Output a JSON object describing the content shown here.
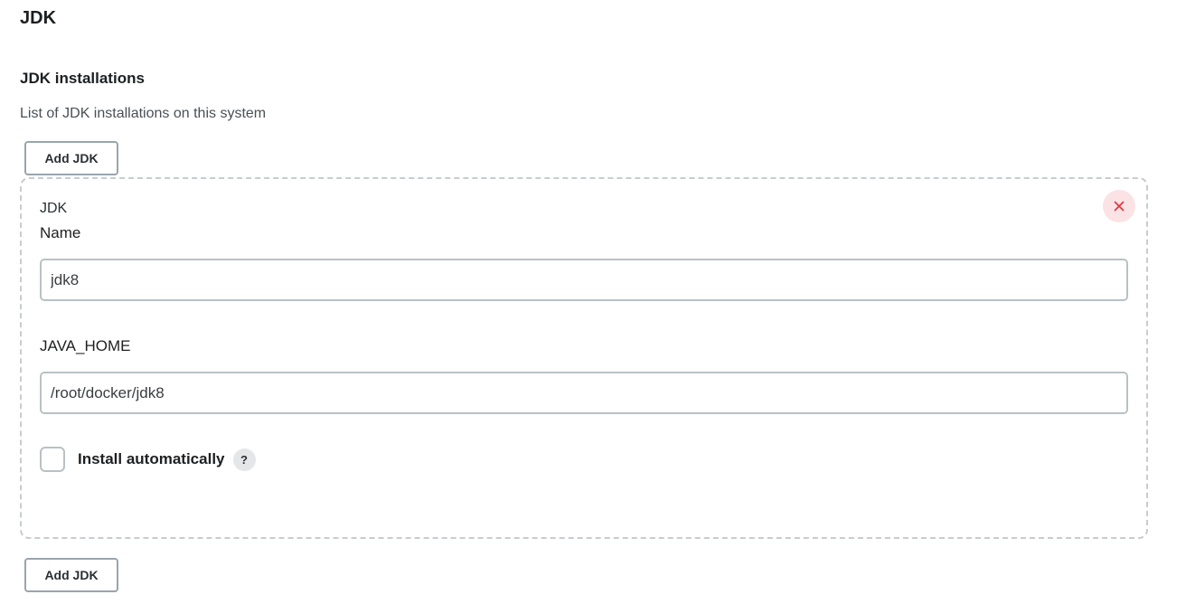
{
  "section": {
    "title": "JDK"
  },
  "jdk_installations": {
    "title": "JDK installations",
    "description": "List of JDK installations on this system",
    "add_button_label": "Add JDK",
    "items": [
      {
        "type_label": "JDK",
        "name_label": "Name",
        "name_value": "jdk8",
        "java_home_label": "JAVA_HOME",
        "java_home_value": "/root/docker/jdk8",
        "install_automatically_label": "Install automatically",
        "install_automatically_checked": false,
        "help_icon": "?",
        "delete_icon": "close-icon"
      }
    ]
  },
  "colors": {
    "delete_accent": "#e0323f",
    "delete_bg": "#fbe2e4",
    "border": "#b9c1c6"
  }
}
